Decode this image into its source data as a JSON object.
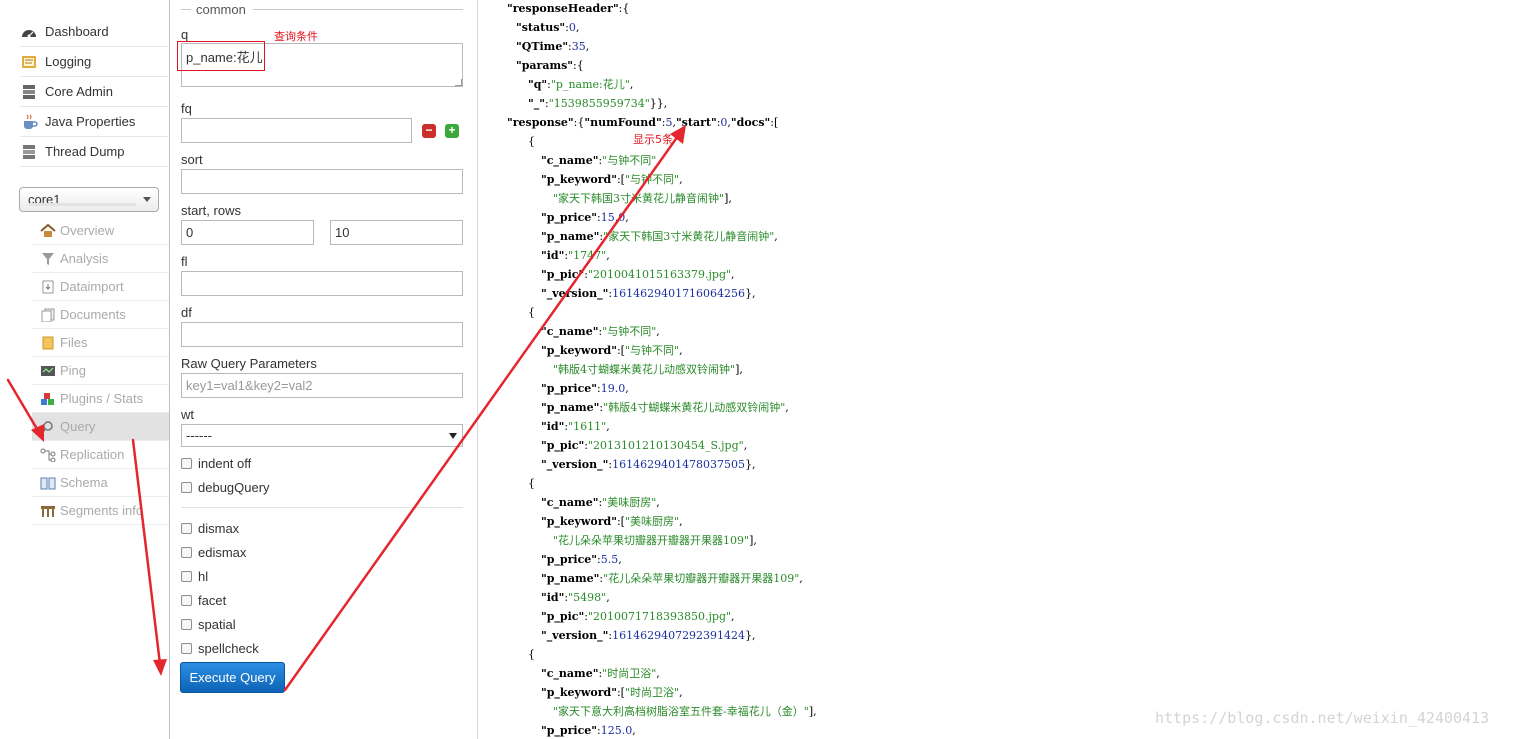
{
  "nav": {
    "main_items": [
      {
        "label": "Dashboard",
        "icon": "dashboard-icon"
      },
      {
        "label": "Logging",
        "icon": "logging-icon"
      },
      {
        "label": "Core Admin",
        "icon": "core-admin-icon"
      },
      {
        "label": "Java Properties",
        "icon": "java-icon"
      },
      {
        "label": "Thread Dump",
        "icon": "thread-dump-icon"
      }
    ],
    "core_selector": "core1",
    "core_items": [
      {
        "label": "Overview",
        "icon": "home-icon"
      },
      {
        "label": "Analysis",
        "icon": "filter-icon"
      },
      {
        "label": "Dataimport",
        "icon": "import-icon"
      },
      {
        "label": "Documents",
        "icon": "documents-icon"
      },
      {
        "label": "Files",
        "icon": "folder-icon"
      },
      {
        "label": "Ping",
        "icon": "ping-icon"
      },
      {
        "label": "Plugins / Stats",
        "icon": "plugins-icon"
      },
      {
        "label": "Query",
        "icon": "search-icon",
        "active": true
      },
      {
        "label": "Replication",
        "icon": "replication-icon"
      },
      {
        "label": "Schema",
        "icon": "schema-icon"
      },
      {
        "label": "Segments info",
        "icon": "segments-icon"
      }
    ]
  },
  "form": {
    "legend": "common",
    "q": {
      "label": "q",
      "value": "p_name:花儿"
    },
    "fq": {
      "label": "fq",
      "value": ""
    },
    "sort": {
      "label": "sort",
      "value": ""
    },
    "start_rows": {
      "label": "start, rows",
      "start": "0",
      "rows": "10"
    },
    "fl": {
      "label": "fl",
      "value": ""
    },
    "df": {
      "label": "df",
      "value": ""
    },
    "raw": {
      "label": "Raw Query Parameters",
      "placeholder": "key1=val1&key2=val2"
    },
    "wt": {
      "label": "wt",
      "selected": "------"
    },
    "options": [
      "indent off",
      "debugQuery"
    ],
    "parsers": [
      "dismax",
      "edismax",
      "hl",
      "facet",
      "spatial",
      "spellcheck"
    ],
    "execute_label": "Execute Query"
  },
  "annotations": {
    "query_condition": "查询条件",
    "show_count": "显示5条"
  },
  "response_lines": [
    [
      [
        0,
        "k",
        "\"responseHeader\""
      ],
      [
        0,
        "p",
        ":{"
      ]
    ],
    [
      [
        1,
        "k",
        "\"status\""
      ],
      [
        1,
        "p",
        ":"
      ],
      [
        1,
        "n",
        "0"
      ],
      [
        1,
        "p",
        ","
      ]
    ],
    [
      [
        1,
        "k",
        "\"QTime\""
      ],
      [
        1,
        "p",
        ":"
      ],
      [
        1,
        "n",
        "35"
      ],
      [
        1,
        "p",
        ","
      ]
    ],
    [
      [
        1,
        "k",
        "\"params\""
      ],
      [
        1,
        "p",
        ":{"
      ]
    ],
    [
      [
        2,
        "k",
        "\"q\""
      ],
      [
        2,
        "p",
        ":"
      ],
      [
        2,
        "s",
        "\"p_name:花儿\""
      ],
      [
        2,
        "p",
        ","
      ]
    ],
    [
      [
        2,
        "k",
        "\"_\""
      ],
      [
        2,
        "p",
        ":"
      ],
      [
        2,
        "s",
        "\"1539855959734\""
      ],
      [
        2,
        "p",
        "}},"
      ]
    ],
    [
      [
        0,
        "k",
        "\"response\""
      ],
      [
        0,
        "p",
        ":{"
      ],
      [
        0,
        "k",
        "\"numFound\""
      ],
      [
        0,
        "p",
        ":"
      ],
      [
        0,
        "n",
        "5"
      ],
      [
        0,
        "p",
        ","
      ],
      [
        0,
        "k",
        "\"start\""
      ],
      [
        0,
        "p",
        ":"
      ],
      [
        0,
        "n",
        "0"
      ],
      [
        0,
        "p",
        ","
      ],
      [
        0,
        "k",
        "\"docs\""
      ],
      [
        0,
        "p",
        ":["
      ]
    ],
    [
      [
        2,
        "p",
        "{"
      ]
    ],
    [
      [
        3,
        "k",
        "\"c_name\""
      ],
      [
        3,
        "p",
        ":"
      ],
      [
        3,
        "s",
        "\"与钟不同\""
      ],
      [
        3,
        "p",
        ","
      ]
    ],
    [
      [
        3,
        "k",
        "\"p_keyword\""
      ],
      [
        3,
        "p",
        ":["
      ],
      [
        3,
        "s",
        "\"与钟不同\""
      ],
      [
        3,
        "p",
        ","
      ]
    ],
    [
      [
        4,
        "s",
        "\"家天下韩国3寸米黄花儿静音闹钟\""
      ],
      [
        4,
        "p",
        "],"
      ]
    ],
    [
      [
        3,
        "k",
        "\"p_price\""
      ],
      [
        3,
        "p",
        ":"
      ],
      [
        3,
        "n",
        "15.0"
      ],
      [
        3,
        "p",
        ","
      ]
    ],
    [
      [
        3,
        "k",
        "\"p_name\""
      ],
      [
        3,
        "p",
        ":"
      ],
      [
        3,
        "s",
        "\"家天下韩国3寸米黄花儿静音闹钟\""
      ],
      [
        3,
        "p",
        ","
      ]
    ],
    [
      [
        3,
        "k",
        "\"id\""
      ],
      [
        3,
        "p",
        ":"
      ],
      [
        3,
        "s",
        "\"1747\""
      ],
      [
        3,
        "p",
        ","
      ]
    ],
    [
      [
        3,
        "k",
        "\"p_pic\""
      ],
      [
        3,
        "p",
        ":"
      ],
      [
        3,
        "s",
        "\"2010041015163379.jpg\""
      ],
      [
        3,
        "p",
        ","
      ]
    ],
    [
      [
        3,
        "k",
        "\"_version_\""
      ],
      [
        3,
        "p",
        ":"
      ],
      [
        3,
        "n",
        "1614629401716064256"
      ],
      [
        3,
        "p",
        "},"
      ]
    ],
    [
      [
        2,
        "p",
        "{"
      ]
    ],
    [
      [
        3,
        "k",
        "\"c_name\""
      ],
      [
        3,
        "p",
        ":"
      ],
      [
        3,
        "s",
        "\"与钟不同\""
      ],
      [
        3,
        "p",
        ","
      ]
    ],
    [
      [
        3,
        "k",
        "\"p_keyword\""
      ],
      [
        3,
        "p",
        ":["
      ],
      [
        3,
        "s",
        "\"与钟不同\""
      ],
      [
        3,
        "p",
        ","
      ]
    ],
    [
      [
        4,
        "s",
        "\"韩版4寸蝴蝶米黄花儿动感双铃闹钟\""
      ],
      [
        4,
        "p",
        "],"
      ]
    ],
    [
      [
        3,
        "k",
        "\"p_price\""
      ],
      [
        3,
        "p",
        ":"
      ],
      [
        3,
        "n",
        "19.0"
      ],
      [
        3,
        "p",
        ","
      ]
    ],
    [
      [
        3,
        "k",
        "\"p_name\""
      ],
      [
        3,
        "p",
        ":"
      ],
      [
        3,
        "s",
        "\"韩版4寸蝴蝶米黄花儿动感双铃闹钟\""
      ],
      [
        3,
        "p",
        ","
      ]
    ],
    [
      [
        3,
        "k",
        "\"id\""
      ],
      [
        3,
        "p",
        ":"
      ],
      [
        3,
        "s",
        "\"1611\""
      ],
      [
        3,
        "p",
        ","
      ]
    ],
    [
      [
        3,
        "k",
        "\"p_pic\""
      ],
      [
        3,
        "p",
        ":"
      ],
      [
        3,
        "s",
        "\"2013101210130454_S.jpg\""
      ],
      [
        3,
        "p",
        ","
      ]
    ],
    [
      [
        3,
        "k",
        "\"_version_\""
      ],
      [
        3,
        "p",
        ":"
      ],
      [
        3,
        "n",
        "1614629401478037505"
      ],
      [
        3,
        "p",
        "},"
      ]
    ],
    [
      [
        2,
        "p",
        "{"
      ]
    ],
    [
      [
        3,
        "k",
        "\"c_name\""
      ],
      [
        3,
        "p",
        ":"
      ],
      [
        3,
        "s",
        "\"美味厨房\""
      ],
      [
        3,
        "p",
        ","
      ]
    ],
    [
      [
        3,
        "k",
        "\"p_keyword\""
      ],
      [
        3,
        "p",
        ":["
      ],
      [
        3,
        "s",
        "\"美味厨房\""
      ],
      [
        3,
        "p",
        ","
      ]
    ],
    [
      [
        4,
        "s",
        "\"花儿朵朵苹果切瓣器开瓣器开果器109\""
      ],
      [
        4,
        "p",
        "],"
      ]
    ],
    [
      [
        3,
        "k",
        "\"p_price\""
      ],
      [
        3,
        "p",
        ":"
      ],
      [
        3,
        "n",
        "5.5"
      ],
      [
        3,
        "p",
        ","
      ]
    ],
    [
      [
        3,
        "k",
        "\"p_name\""
      ],
      [
        3,
        "p",
        ":"
      ],
      [
        3,
        "s",
        "\"花儿朵朵苹果切瓣器开瓣器开果器109\""
      ],
      [
        3,
        "p",
        ","
      ]
    ],
    [
      [
        3,
        "k",
        "\"id\""
      ],
      [
        3,
        "p",
        ":"
      ],
      [
        3,
        "s",
        "\"5498\""
      ],
      [
        3,
        "p",
        ","
      ]
    ],
    [
      [
        3,
        "k",
        "\"p_pic\""
      ],
      [
        3,
        "p",
        ":"
      ],
      [
        3,
        "s",
        "\"2010071718393850.jpg\""
      ],
      [
        3,
        "p",
        ","
      ]
    ],
    [
      [
        3,
        "k",
        "\"_version_\""
      ],
      [
        3,
        "p",
        ":"
      ],
      [
        3,
        "n",
        "1614629407292391424"
      ],
      [
        3,
        "p",
        "},"
      ]
    ],
    [
      [
        2,
        "p",
        "{"
      ]
    ],
    [
      [
        3,
        "k",
        "\"c_name\""
      ],
      [
        3,
        "p",
        ":"
      ],
      [
        3,
        "s",
        "\"时尚卫浴\""
      ],
      [
        3,
        "p",
        ","
      ]
    ],
    [
      [
        3,
        "k",
        "\"p_keyword\""
      ],
      [
        3,
        "p",
        ":["
      ],
      [
        3,
        "s",
        "\"时尚卫浴\""
      ],
      [
        3,
        "p",
        ","
      ]
    ],
    [
      [
        4,
        "s",
        "\"家天下意大利高档树脂浴室五件套-幸福花儿（金）\""
      ],
      [
        4,
        "p",
        "],"
      ]
    ],
    [
      [
        3,
        "k",
        "\"p_price\""
      ],
      [
        3,
        "p",
        ":"
      ],
      [
        3,
        "n",
        "125.0"
      ],
      [
        3,
        "p",
        ","
      ]
    ]
  ],
  "watermark": "https://blog.csdn.net/weixin_42400413",
  "colors": {
    "annotation": "#e0141e",
    "button": "#1371c9",
    "string": "#2a8b2a",
    "number": "#1a2fa0"
  }
}
